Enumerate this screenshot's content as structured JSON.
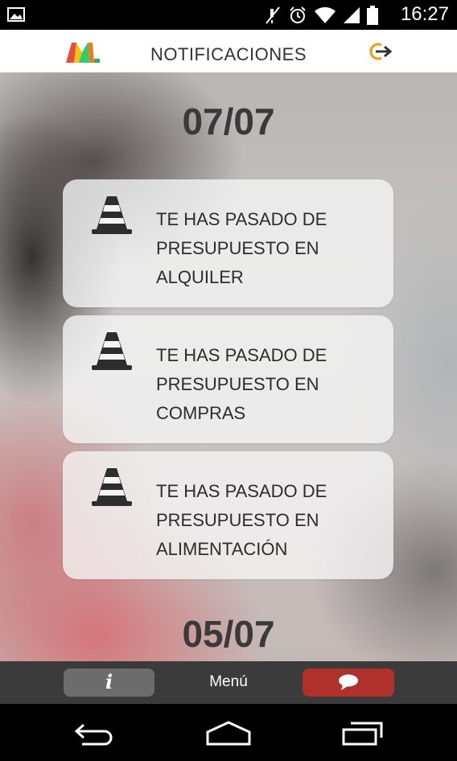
{
  "status_bar": {
    "time": "16:27",
    "icons": [
      "image-icon",
      "mute-icon",
      "alarm-icon",
      "wifi-icon",
      "signal-icon",
      "battery-icon"
    ]
  },
  "header": {
    "title": "NOTIFICACIONES",
    "logo": "app-logo-m",
    "logout_icon": "logout-icon"
  },
  "notifications": {
    "groups": [
      {
        "date": "07/07",
        "items": [
          {
            "icon": "traffic-cone-icon",
            "lines": [
              "TE HAS PASADO DE",
              "PRESUPUESTO EN",
              "ALQUILER"
            ]
          },
          {
            "icon": "traffic-cone-icon",
            "lines": [
              "TE HAS PASADO DE",
              "PRESUPUESTO EN",
              "COMPRAS"
            ]
          },
          {
            "icon": "traffic-cone-icon",
            "lines": [
              "TE HAS PASADO DE",
              "PRESUPUESTO EN",
              "ALIMENTACIÓN"
            ]
          }
        ]
      },
      {
        "date": "05/07",
        "items": []
      }
    ]
  },
  "bottom_bar": {
    "info_label": "i",
    "menu_label": "Menú",
    "chat_icon": "chat-bubble-icon"
  },
  "colors": {
    "header_bg": "#ffffff",
    "bottom_bar_bg": "#3b3b3b",
    "info_button_bg": "#6c6c6c",
    "chat_button_bg": "#b0302c",
    "logout_icon": "#f39c12",
    "text_dark": "#2d2d2d"
  }
}
